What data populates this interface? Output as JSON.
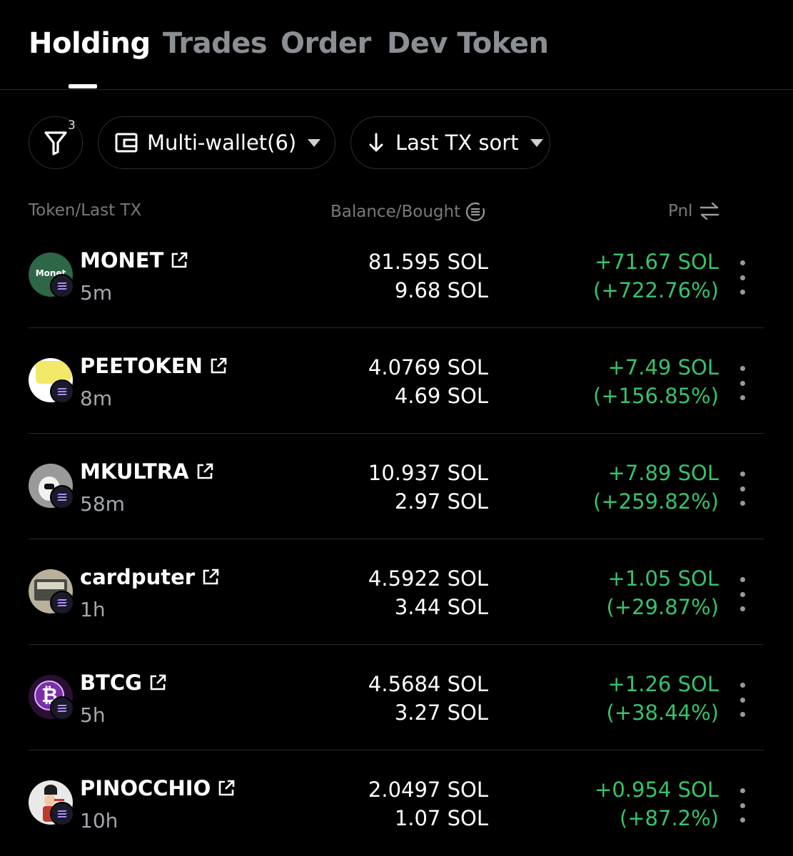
{
  "tabs": [
    {
      "label": "Holding",
      "active": true
    },
    {
      "label": "Trades",
      "active": false
    },
    {
      "label": "Order",
      "active": false
    },
    {
      "label": "Dev Token",
      "active": false
    }
  ],
  "filters": {
    "filter_count": "3",
    "wallet_label": "Multi-wallet(6)",
    "sort_label": "Last TX sort"
  },
  "columns": {
    "token": "Token/Last TX",
    "balance": "Balance/Bought",
    "pnl": "Pnl"
  },
  "colors": {
    "background": "#000000",
    "positive": "#37c26a",
    "muted": "#8b8e93"
  },
  "holdings": [
    {
      "name": "MONET",
      "time": "5m",
      "balance": "81.595 SOL",
      "bought": "9.68 SOL",
      "pnl": "+71.67 SOL",
      "pnl_pct": "(+722.76%)",
      "avatar_text": "Monet"
    },
    {
      "name": "PEETOKEN",
      "time": "8m",
      "balance": "4.0769 SOL",
      "bought": "4.69 SOL",
      "pnl": "+7.49 SOL",
      "pnl_pct": "(+156.85%)"
    },
    {
      "name": "MKULTRA",
      "time": "58m",
      "balance": "10.937 SOL",
      "bought": "2.97 SOL",
      "pnl": "+7.89 SOL",
      "pnl_pct": "(+259.82%)"
    },
    {
      "name": "cardputer",
      "time": "1h",
      "balance": "4.5922 SOL",
      "bought": "3.44 SOL",
      "pnl": "+1.05 SOL",
      "pnl_pct": "(+29.87%)"
    },
    {
      "name": "BTCG",
      "time": "5h",
      "balance": "4.5684 SOL",
      "bought": "3.27 SOL",
      "pnl": "+1.26 SOL",
      "pnl_pct": "(+38.44%)"
    },
    {
      "name": "PINOCCHIO",
      "time": "10h",
      "balance": "2.0497 SOL",
      "bought": "1.07 SOL",
      "pnl": "+0.954 SOL",
      "pnl_pct": "(+87.2%)"
    }
  ]
}
